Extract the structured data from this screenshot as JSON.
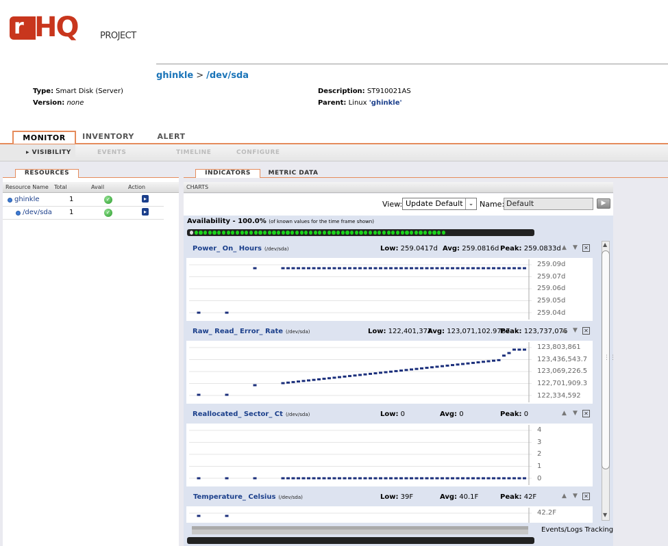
{
  "logo": {
    "r": "r",
    "hq": "HQ",
    "project": "PROJECT"
  },
  "breadcrumb": {
    "parent": "ghinkle",
    "separator": ">",
    "current": "/dev/sda"
  },
  "properties": {
    "type_label": "Type:",
    "type_value": "Smart Disk (Server)",
    "version_label": "Version:",
    "version_value": "none",
    "description_label": "Description:",
    "description_value": "ST910021AS",
    "parent_label": "Parent:",
    "parent_prefix": "Linux",
    "parent_value": "'ghinkle'"
  },
  "main_tabs": [
    "MONITOR",
    "INVENTORY",
    "ALERT"
  ],
  "sub_tabs": [
    "VISIBILITY",
    "EVENTS",
    "TIMELINE",
    "CONFIGURE"
  ],
  "left_panel": {
    "tab": "RESOURCES",
    "columns": [
      "Resource Name",
      "Total",
      "Avail",
      "Action"
    ],
    "rows": [
      {
        "name": "ghinkle",
        "total": "1",
        "status": "available"
      },
      {
        "name": "/dev/sda",
        "total": "1",
        "status": "available"
      }
    ]
  },
  "right_panel": {
    "tabs": [
      "INDICATORS",
      "METRIC DATA"
    ],
    "section": "CHARTS",
    "view_label": "View:",
    "view_value": "Update Default",
    "name_label": "Name:",
    "name_value": "Default"
  },
  "availability": {
    "title": "Availability - 100.0%",
    "note": "(of known values for the time frame shown)",
    "percent": 100
  },
  "metrics": [
    {
      "name": "Power_ On_ Hours",
      "resource": "(/dev/sda)",
      "low_label": "Low:",
      "low": "259.0417d",
      "avg_label": "Avg:",
      "avg": "259.0816d",
      "peak_label": "Peak:",
      "peak": "259.0833d",
      "yticks": [
        "259.09d",
        "259.07d",
        "259.06d",
        "259.05d",
        "259.04d"
      ]
    },
    {
      "name": "Raw_ Read_ Error_ Rate",
      "resource": "(/dev/sda)",
      "low_label": "Low:",
      "low": "122,401,377",
      "avg_label": "Avg:",
      "avg": "123,071,102.9787",
      "peak_label": "Peak:",
      "peak": "123,737,076",
      "yticks": [
        "123,803,861",
        "123,436,543.7",
        "123,069,226.5",
        "122,701,909.3",
        "122,334,592"
      ]
    },
    {
      "name": "Reallocated_ Sector_ Ct",
      "resource": "(/dev/sda)",
      "low_label": "Low:",
      "low": "0",
      "avg_label": "Avg:",
      "avg": "0",
      "peak_label": "Peak:",
      "peak": "0",
      "yticks": [
        "4",
        "3",
        "2",
        "1",
        "0"
      ]
    },
    {
      "name": "Temperature_ Celsius",
      "resource": "(/dev/sda)",
      "low_label": "Low:",
      "low": "39F",
      "avg_label": "Avg:",
      "avg": "40.1F",
      "peak_label": "Peak:",
      "peak": "42F",
      "yticks": [
        "42.2F"
      ]
    }
  ],
  "footer": {
    "events_tracking": "Events/Logs Tracking"
  },
  "colors": {
    "accent": "#e58b5b",
    "link": "#1b3f8b",
    "brand": "#c8361d",
    "avail_green": "#1bd31b",
    "plot_point": "#1b2f7b"
  }
}
